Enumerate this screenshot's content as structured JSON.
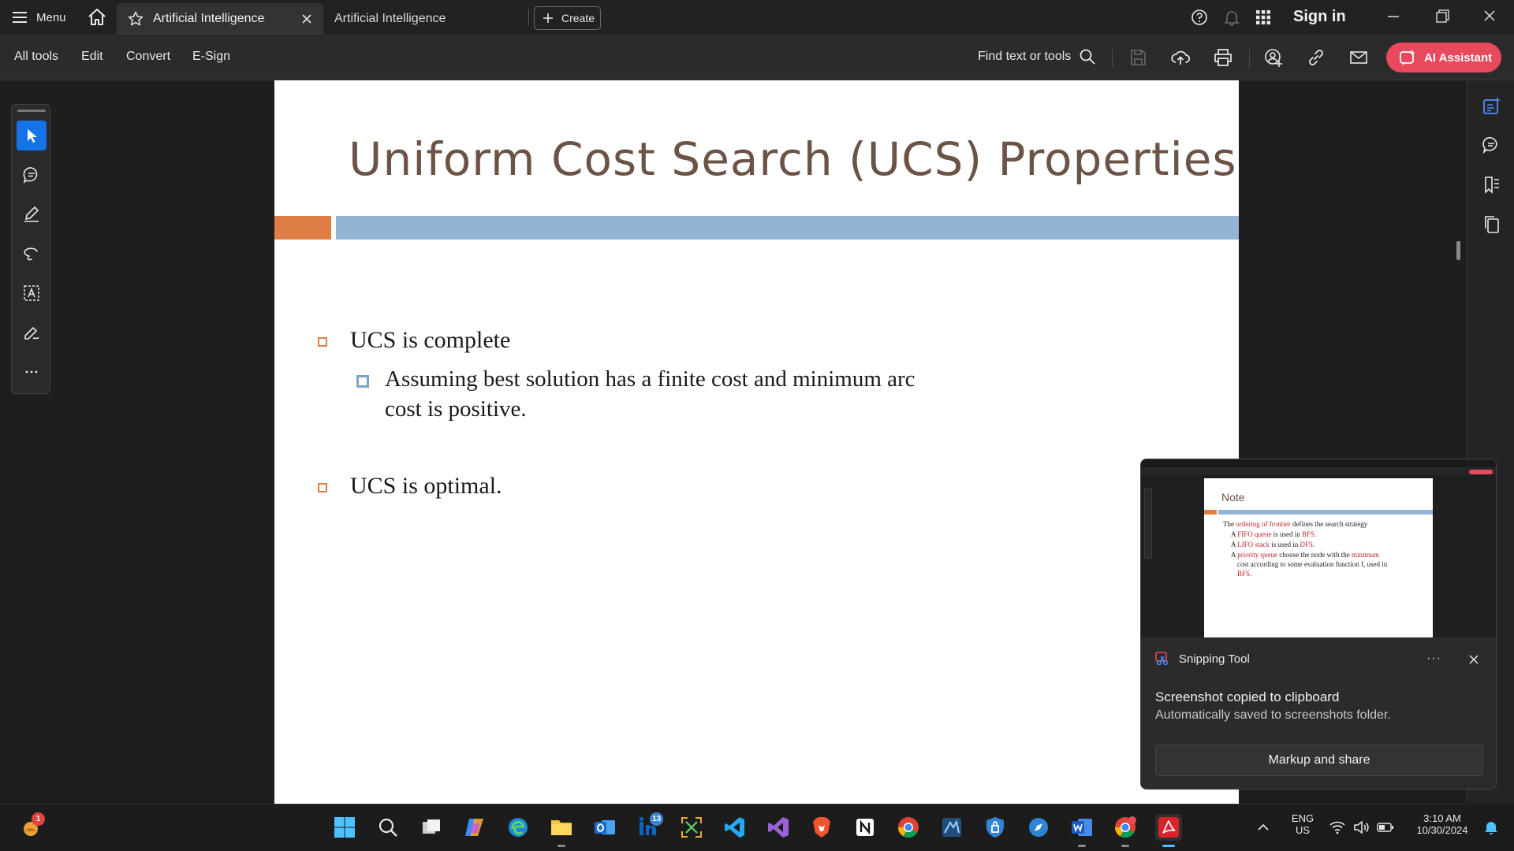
{
  "titlebar": {
    "menu_label": "Menu",
    "tabs": [
      {
        "label": "Artificial Intelligence",
        "active": true
      },
      {
        "label": "Artificial Intelligence",
        "active": false
      }
    ],
    "create_label": "Create",
    "sign_in_label": "Sign in"
  },
  "toolbar": {
    "menus": [
      "All tools",
      "Edit",
      "Convert",
      "E-Sign"
    ],
    "find_label": "Find text or tools",
    "ai_assistant_label": "AI Assistant",
    "accent_color": "#e8495d"
  },
  "document": {
    "slide_title": "Uniform Cost Search (UCS) Properties",
    "bullets": [
      {
        "text": "UCS is complete",
        "sub": [
          "Assuming best solution has a finite cost and minimum arc",
          "cost is positive."
        ]
      },
      {
        "text": "UCS is optimal.",
        "sub": []
      }
    ],
    "colors": {
      "title": "#6b5446",
      "orange_band": "#e07f45",
      "blue_band": "#94b4d4"
    }
  },
  "toast": {
    "app_name": "Snipping Tool",
    "heading": "Screenshot copied to clipboard",
    "subtext": "Automatically saved to screenshots folder.",
    "button_label": "Markup and share",
    "more_label": "···",
    "thumbnail": {
      "title": "Note",
      "lines": [
        [
          "The ",
          "ordering of frontier",
          " defines the  search strategy"
        ],
        [
          "A ",
          "FIFO queue",
          " is used in  ",
          "BFS."
        ],
        [
          "A ",
          "LIFO stack",
          " is used in  ",
          "DFS."
        ],
        [
          "A ",
          "priority queue",
          " choose the node with the ",
          "minimum"
        ],
        [
          "cost according to some evaluation function f, used in"
        ],
        [
          "",
          "BFS."
        ]
      ]
    }
  },
  "taskbar": {
    "widgets_badge": "1",
    "linkedin_badge": "13",
    "language": "ENG",
    "region": "US",
    "time": "3:10 AM",
    "date": "10/30/2024"
  }
}
